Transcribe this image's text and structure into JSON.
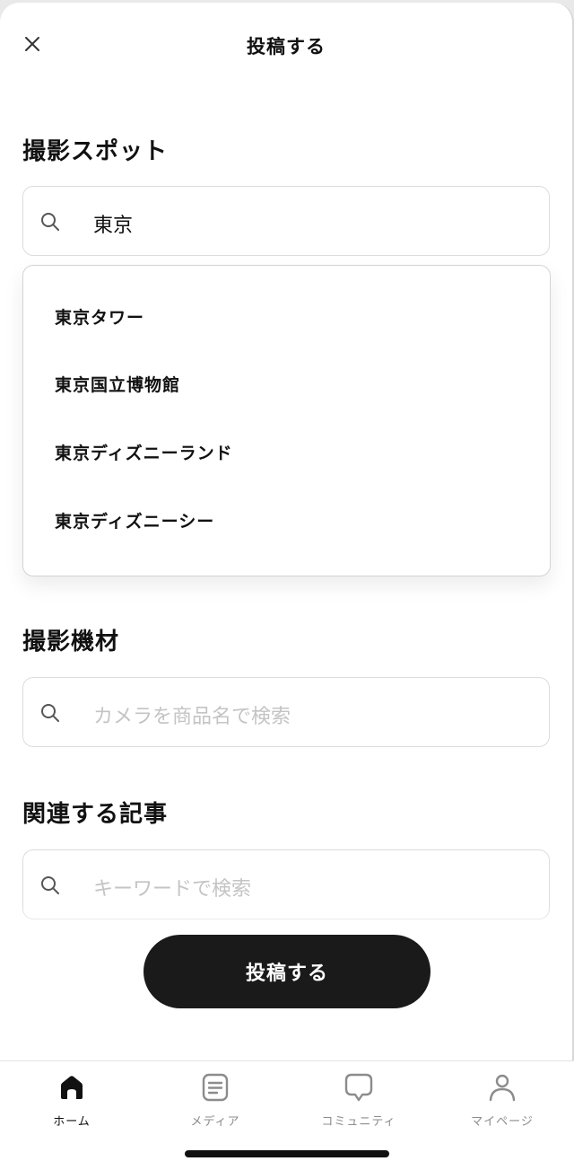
{
  "header": {
    "title": "投稿する",
    "close_icon": "close-icon"
  },
  "spot": {
    "title": "撮影スポット",
    "search_value": "東京",
    "suggestions": [
      "東京タワー",
      "東京国立博物館",
      "東京ディズニーランド",
      "東京ディズニーシー"
    ]
  },
  "equipment": {
    "title": "撮影機材",
    "placeholder": "カメラを商品名で検索"
  },
  "articles": {
    "title": "関連する記事",
    "placeholder": "キーワードで検索"
  },
  "submit_label": "投稿する",
  "tabbar": {
    "tabs": [
      {
        "label": "ホーム",
        "icon": "home-icon",
        "active": true
      },
      {
        "label": "メディア",
        "icon": "media-icon",
        "active": false
      },
      {
        "label": "コミュニティ",
        "icon": "chat-bubble-icon",
        "active": false
      },
      {
        "label": "マイページ",
        "icon": "person-icon",
        "active": false
      }
    ]
  },
  "colors": {
    "primary": "#1a1a1a",
    "placeholder": "#c4c4c4",
    "inactive_tab": "#8c8c8c"
  }
}
